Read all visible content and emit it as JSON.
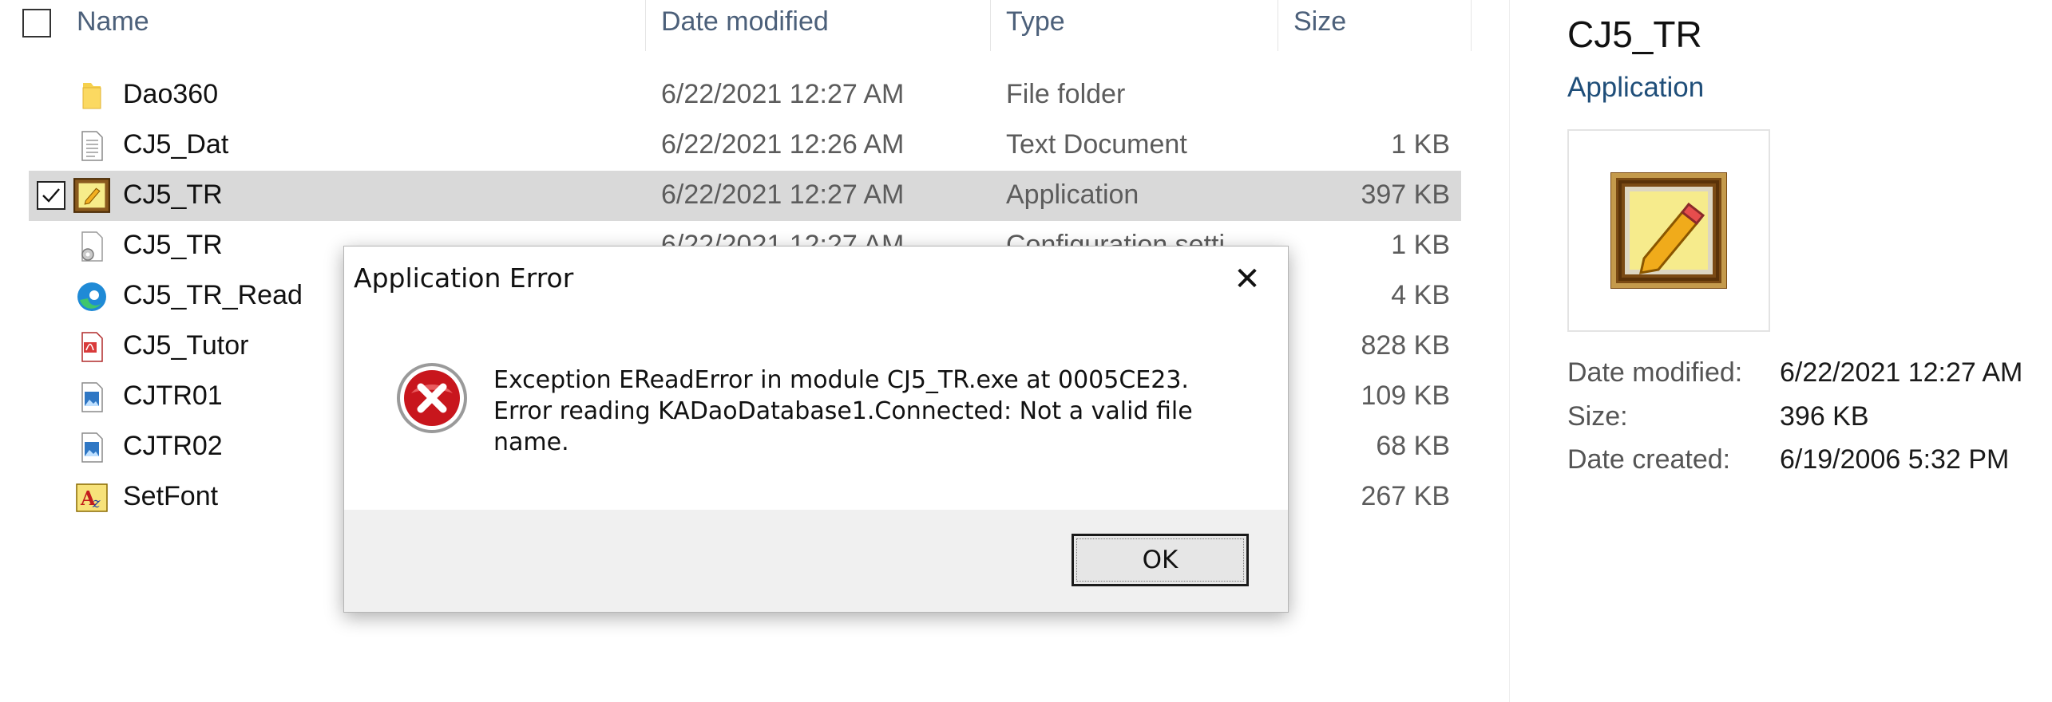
{
  "columns": {
    "name": "Name",
    "date_modified": "Date modified",
    "type": "Type",
    "size": "Size"
  },
  "files": [
    {
      "name": "Dao360",
      "date": "6/22/2021 12:27 AM",
      "type": "File folder",
      "size": "",
      "icon": "folder-icon"
    },
    {
      "name": "CJ5_Dat",
      "date": "6/22/2021 12:26 AM",
      "type": "Text Document",
      "size": "1 KB",
      "icon": "text-document-icon"
    },
    {
      "name": "CJ5_TR",
      "date": "6/22/2021 12:27 AM",
      "type": "Application",
      "size": "397 KB",
      "icon": "application-icon",
      "selected": true
    },
    {
      "name": "CJ5_TR",
      "date": "6/22/2021 12:27 AM",
      "type": "Configuration setti",
      "size": "1 KB",
      "icon": "config-settings-icon"
    },
    {
      "name": "CJ5_TR_Read",
      "date": "",
      "type": "",
      "size": "4 KB",
      "icon": "edge-browser-icon"
    },
    {
      "name": "CJ5_Tutor",
      "date": "",
      "type": "",
      "size": "828 KB",
      "icon": "pdf-document-icon"
    },
    {
      "name": "CJTR01",
      "date": "",
      "type": "",
      "size": "109 KB",
      "icon": "image-file-icon"
    },
    {
      "name": "CJTR02",
      "date": "",
      "type": "",
      "size": "68 KB",
      "icon": "image-file-icon"
    },
    {
      "name": "SetFont",
      "date": "",
      "type": "",
      "size": "267 KB",
      "icon": "font-app-icon"
    }
  ],
  "details": {
    "title": "CJ5_TR",
    "type": "Application",
    "thumbnail_icon": "application-icon",
    "props": [
      {
        "label": "Date modified:",
        "value": "6/22/2021 12:27 AM"
      },
      {
        "label": "Size:",
        "value": "396 KB"
      },
      {
        "label": "Date created:",
        "value": "6/19/2006 5:32 PM"
      }
    ]
  },
  "dialog": {
    "title": "Application Error",
    "close_glyph": "✕",
    "message_lines": [
      "Exception EReadError in module CJ5_TR.exe at 0005CE23.",
      "Error reading KADaoDatabase1.Connected: Not a valid file",
      "name."
    ],
    "ok_label": "OK",
    "icon": "error-icon"
  },
  "colors": {
    "selected_row": "#d9d9d9",
    "header_text": "#4c607a",
    "details_type_link": "#1f4e79",
    "error_red": "#c8161d"
  }
}
